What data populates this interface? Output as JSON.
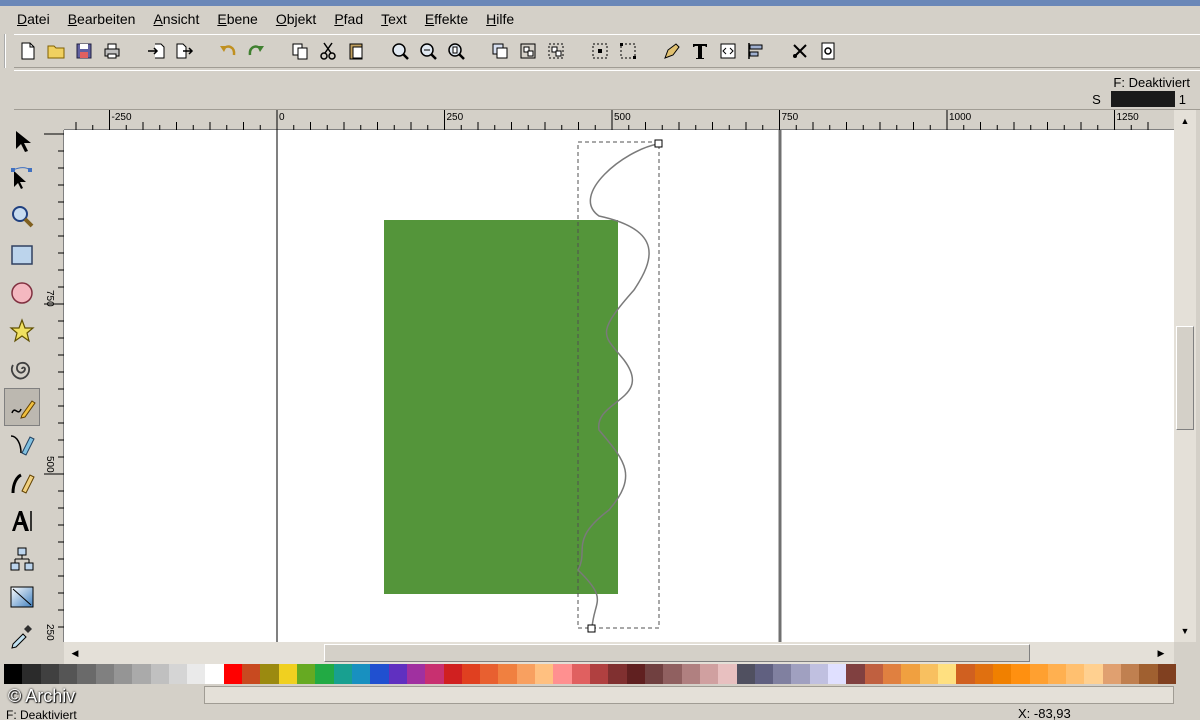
{
  "menubar": {
    "items": [
      "Datei",
      "Bearbeiten",
      "Ansicht",
      "Ebene",
      "Objekt",
      "Pfad",
      "Text",
      "Effekte",
      "Hilfe"
    ]
  },
  "style_indicator": {
    "fill": "F: Deaktiviert",
    "stroke_label": "S",
    "stroke_width": "1",
    "stroke_color": "#1a1a1a"
  },
  "ruler_h": {
    "labels": [
      "-250",
      "0",
      "250",
      "500",
      "750",
      "1000",
      "1250"
    ]
  },
  "ruler_v": {
    "labels": [
      "750",
      "500",
      "250"
    ]
  },
  "canvas": {
    "rect_fill": "#54953a"
  },
  "palette": {
    "colors": [
      "#000000",
      "#2b2b2b",
      "#404040",
      "#555555",
      "#6a6a6a",
      "#808080",
      "#959595",
      "#aaaaaa",
      "#c0c0c0",
      "#d5d5d5",
      "#eaeaea",
      "#ffffff",
      "#ff0000",
      "#c84a20",
      "#9b8a10",
      "#f0d020",
      "#66aa22",
      "#22aa44",
      "#18a090",
      "#1890c0",
      "#2050d0",
      "#6030c0",
      "#a030a0",
      "#c83070",
      "#d02020",
      "#e04020",
      "#e86030",
      "#f08040",
      "#f8a060",
      "#ffc080",
      "#ff9090",
      "#e06060",
      "#b04040",
      "#803030",
      "#602020",
      "#704040",
      "#906060",
      "#b08080",
      "#d0a0a0",
      "#e8c0c0",
      "#505060",
      "#606080",
      "#8080a0",
      "#a0a0c0",
      "#c0c0e0",
      "#e0e0ff",
      "#804040",
      "#c06040",
      "#e08040",
      "#f0a040",
      "#f8c060",
      "#ffe080",
      "#d06020",
      "#e07010",
      "#f08000",
      "#ff9010",
      "#ffa030",
      "#ffb050",
      "#ffc070",
      "#ffd090",
      "#e0a070",
      "#c08050",
      "#a06030",
      "#804020"
    ]
  },
  "status": {
    "watermark": "© Archiv",
    "fill_state": "F: Deaktiviert",
    "coords": "X: -83,93"
  }
}
